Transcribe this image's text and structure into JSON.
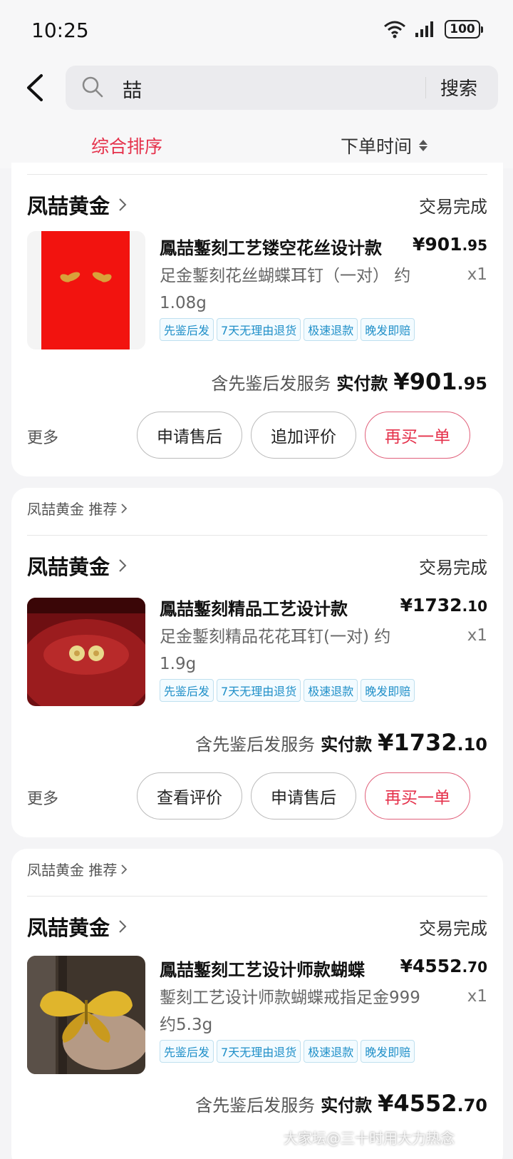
{
  "status_bar": {
    "time": "10:25",
    "battery": "100"
  },
  "search": {
    "query": "喆",
    "button_label": "搜索"
  },
  "sort": {
    "primary_label": "综合排序",
    "time_label": "下单时间"
  },
  "orders": [
    {
      "recommend_label": "",
      "shop": "凤喆黄金",
      "status": "交易完成",
      "title": "鳳喆鏨刻工艺镂空花丝设计款",
      "price_int": "¥901",
      "price_dec": ".95",
      "spec": "足金鏨刻花丝蝴蝶耳钉（一对） 约1.08g",
      "qty": "x1",
      "tags": [
        "先鉴后发",
        "7天无理由退货",
        "极速退款",
        "晚发即赔"
      ],
      "paid_prefix": "含先鉴后发服务",
      "paid_label": "实付款",
      "paid_int": "¥901",
      "paid_dec": ".95",
      "more_label": "更多",
      "buttons": [
        "申请售后",
        "追加评价",
        "再买一单"
      ]
    },
    {
      "recommend_label": "凤喆黄金 推荐",
      "shop": "凤喆黄金",
      "status": "交易完成",
      "title": "鳳喆鏨刻精品工艺设计款",
      "price_int": "¥1732",
      "price_dec": ".10",
      "spec": "足金鏨刻精品花花耳钉(一对) 约1.9g",
      "qty": "x1",
      "tags": [
        "先鉴后发",
        "7天无理由退货",
        "极速退款",
        "晚发即赔"
      ],
      "paid_prefix": "含先鉴后发服务",
      "paid_label": "实付款",
      "paid_int": "¥1732",
      "paid_dec": ".10",
      "more_label": "更多",
      "buttons": [
        "查看评价",
        "申请售后",
        "再买一单"
      ]
    },
    {
      "recommend_label": "凤喆黄金 推荐",
      "shop": "凤喆黄金",
      "status": "交易完成",
      "title": "鳳喆鏨刻工艺设计师款蝴蝶",
      "price_int": "¥4552",
      "price_dec": ".70",
      "spec": "鏨刻工艺设计师款蝴蝶戒指足金999 约5.3g",
      "qty": "x1",
      "tags": [
        "先鉴后发",
        "7天无理由退货",
        "极速退款",
        "晚发即赔"
      ],
      "paid_prefix": "含先鉴后发服务",
      "paid_label": "实付款",
      "paid_int": "¥4552",
      "paid_dec": ".70"
    }
  ],
  "watermark": "大家坛@三十时用大力热念",
  "colors": {
    "accent": "#e5314b",
    "tag_blue": "#1f8fc8",
    "background": "#f4f4f6"
  }
}
